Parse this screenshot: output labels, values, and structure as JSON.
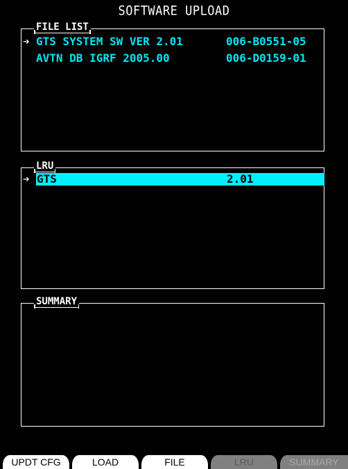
{
  "title": "SOFTWARE UPLOAD",
  "file_list": {
    "label": "FILE LIST",
    "items": [
      {
        "name": "GTS SYSTEM SW VER 2.01",
        "part_number": "006-B0551-05",
        "selected": true
      },
      {
        "name": "AVTN DB IGRF 2005.00",
        "part_number": "006-D0159-01",
        "selected": false
      }
    ]
  },
  "lru": {
    "label": "LRU",
    "items": [
      {
        "name": "GTS",
        "version": "2.01",
        "selected": true
      }
    ]
  },
  "summary": {
    "label": "SUMMARY"
  },
  "softkeys": [
    {
      "label": "UPDT CFG",
      "enabled": true
    },
    {
      "label": "LOAD",
      "enabled": true
    },
    {
      "label": "FILE",
      "enabled": true
    },
    {
      "label": "LRU",
      "enabled": false
    },
    {
      "label": "SUMMARY",
      "enabled": false
    }
  ],
  "selector_glyph": "➔",
  "colors": {
    "background": "#000000",
    "text_cyan": "#00e5f5",
    "highlight": "#00f0ff",
    "softkey_bg": "#ffffff",
    "softkey_disabled_bg": "#808080"
  }
}
